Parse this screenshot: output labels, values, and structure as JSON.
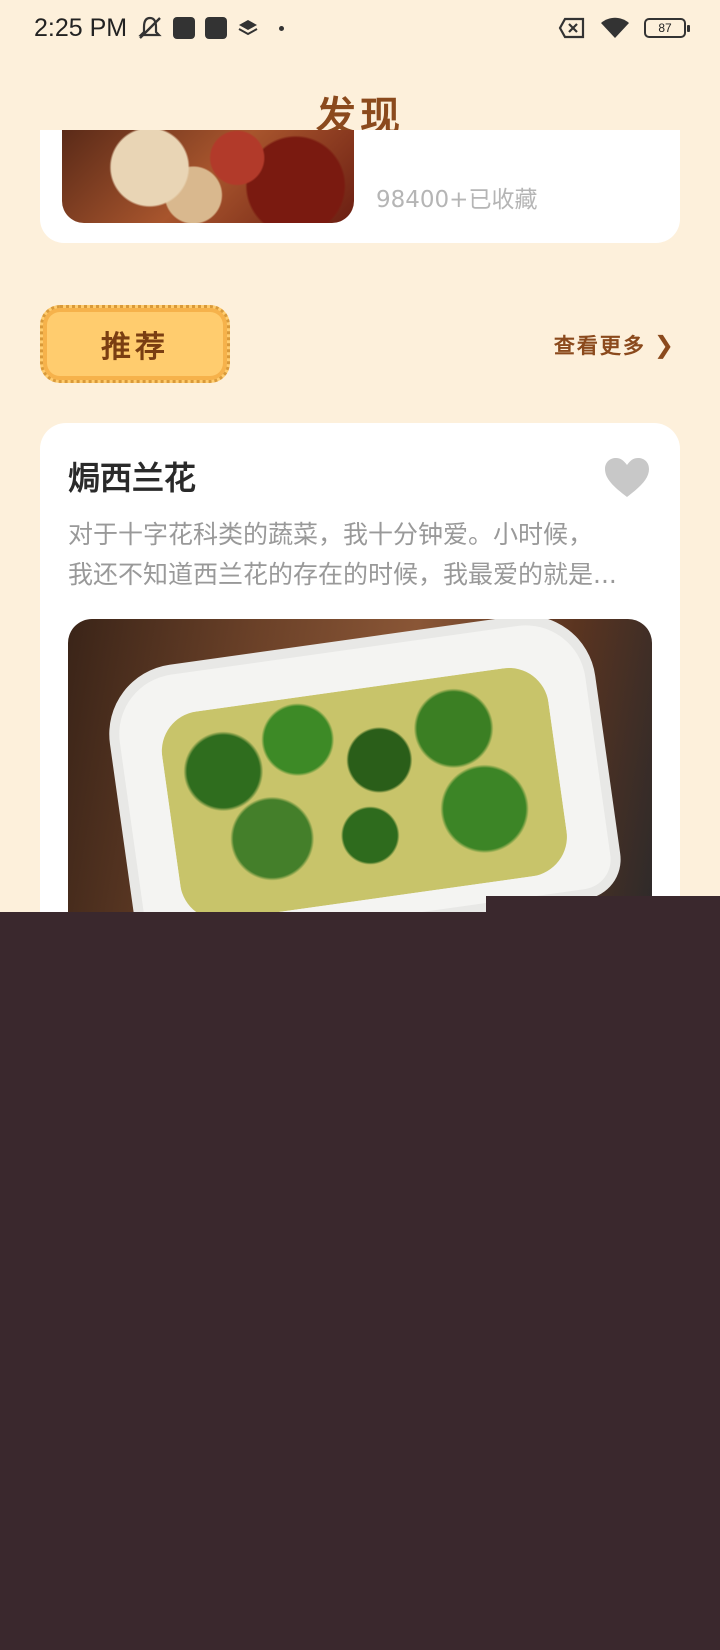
{
  "status_bar": {
    "time": "2:25 PM",
    "battery": "87",
    "icons": [
      "mute-icon",
      "app-icon",
      "app-icon",
      "layers-icon",
      "dot-icon",
      "sim-off-icon",
      "wifi-icon",
      "battery-icon"
    ]
  },
  "header": {
    "title": "发现"
  },
  "top_card": {
    "collect_count": "98400+已收藏"
  },
  "recommend": {
    "badge_label": "推荐",
    "see_more_label": "查看更多"
  },
  "recipe": {
    "title": "焗西兰花",
    "desc_line1": "对于十字花科类的蔬菜，我十分钟爱。小时候，",
    "desc_line2": "我还不知道西兰花的存在的时候，我最爱的就是..."
  },
  "colors": {
    "background": "#fdf0db",
    "accent_brown": "#8b4a1d",
    "badge_yellow": "#ffcc6e",
    "overlay_dark": "#3a282d"
  }
}
